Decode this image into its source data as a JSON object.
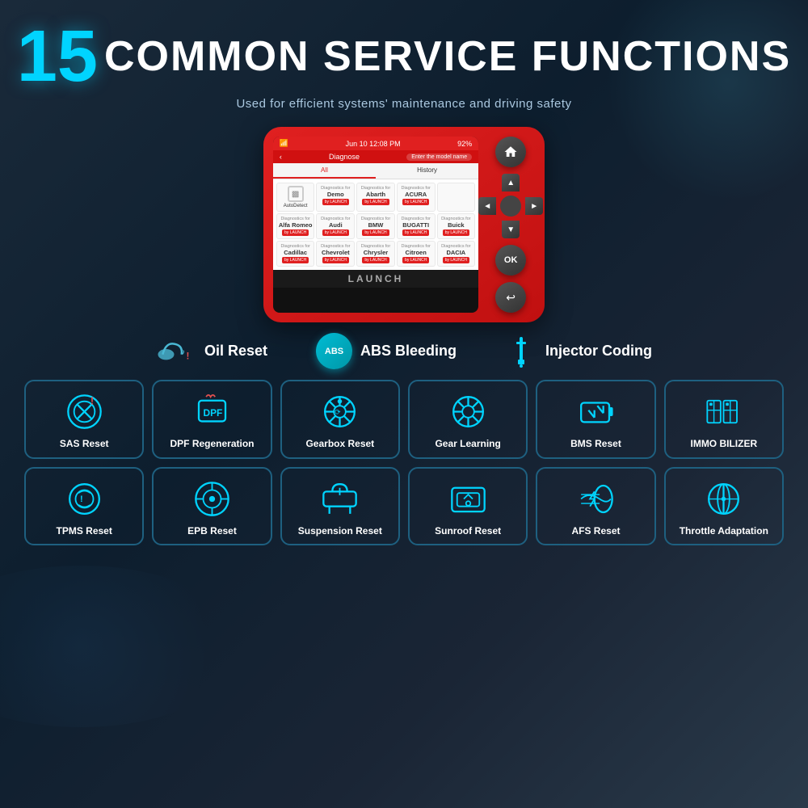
{
  "header": {
    "number": "15",
    "title": "COMMON SERVICE FUNCTIONS",
    "subtitle": "Used for efficient systems' maintenance and driving safety"
  },
  "device": {
    "status_bar": {
      "wifi": "WiFi",
      "time": "Jun 10  12:08 PM",
      "battery": "92%"
    },
    "nav_bar": {
      "back": "<",
      "title": "Diagnose",
      "search_placeholder": "Enter the model name"
    },
    "tabs": [
      "All",
      "History"
    ],
    "brands": [
      {
        "label": "AutoDetect",
        "icon": true
      },
      {
        "diag": "Diagnostics for",
        "name": "Demo",
        "badge": "by LAUNCH"
      },
      {
        "diag": "Diagnostics for",
        "name": "Abarth",
        "badge": "by LAUNCH"
      },
      {
        "diag": "Diagnostics for",
        "name": "ACURA",
        "badge": "by LAUNCH"
      },
      {
        "diag": "Diagnostics for",
        "name": "Alfa Romeo",
        "badge": "by LAUNCH"
      },
      {
        "diag": "Diagnostics for",
        "name": "Audi",
        "badge": "by LAUNCH"
      },
      {
        "diag": "Diagnostics for",
        "name": "BMW",
        "badge": "by LAUNCH"
      },
      {
        "diag": "Diagnostics for",
        "name": "BUGATTI",
        "badge": "by LAUNCH"
      },
      {
        "diag": "Diagnostics for",
        "name": "Buick",
        "badge": "by LAUNCH"
      },
      {
        "diag": "Diagnostics for",
        "name": "Cadillac",
        "badge": "by LAUNCH"
      },
      {
        "diag": "Diagnostics for",
        "name": "Chevrolet",
        "badge": "by LAUNCH"
      },
      {
        "diag": "Diagnostics for",
        "name": "Chrysler",
        "badge": "by LAUNCH"
      },
      {
        "diag": "Diagnostics for",
        "name": "Citroen",
        "badge": "by LAUNCH"
      },
      {
        "diag": "Diagnostics for",
        "name": "DACIA",
        "badge": "by LAUNCH"
      }
    ],
    "launch_label": "LAUNCH"
  },
  "service_icons": [
    {
      "id": "oil-reset",
      "label": "Oil Reset",
      "type": "oil"
    },
    {
      "id": "abs-bleeding",
      "label": "ABS Bleeding",
      "type": "abs",
      "badge": "ABS"
    },
    {
      "id": "injector-coding",
      "label": "Injector Coding",
      "type": "injector"
    }
  ],
  "functions": [
    {
      "id": "sas-reset",
      "label": "SAS Reset"
    },
    {
      "id": "dpf-regeneration",
      "label": "DPF Regeneration"
    },
    {
      "id": "gearbox-reset",
      "label": "Gearbox Reset"
    },
    {
      "id": "gear-learning",
      "label": "Gear Learning"
    },
    {
      "id": "bms-reset",
      "label": "BMS Reset"
    },
    {
      "id": "immobilizer",
      "label": "IMMO BILIZER"
    },
    {
      "id": "tpms-reset",
      "label": "TPMS Reset"
    },
    {
      "id": "epb-reset",
      "label": "EPB Reset"
    },
    {
      "id": "suspension-reset",
      "label": "Suspension Reset"
    },
    {
      "id": "sunroof-reset",
      "label": "Sunroof Reset"
    },
    {
      "id": "afs-reset",
      "label": "AFS Reset"
    },
    {
      "id": "throttle-adaptation",
      "label": "Throttle Adaptation"
    }
  ],
  "colors": {
    "accent_cyan": "#00d4ff",
    "accent_red": "#e02020",
    "border_blue": "#1e6080",
    "text_white": "#ffffff",
    "bg_dark": "#0d1e2e"
  }
}
